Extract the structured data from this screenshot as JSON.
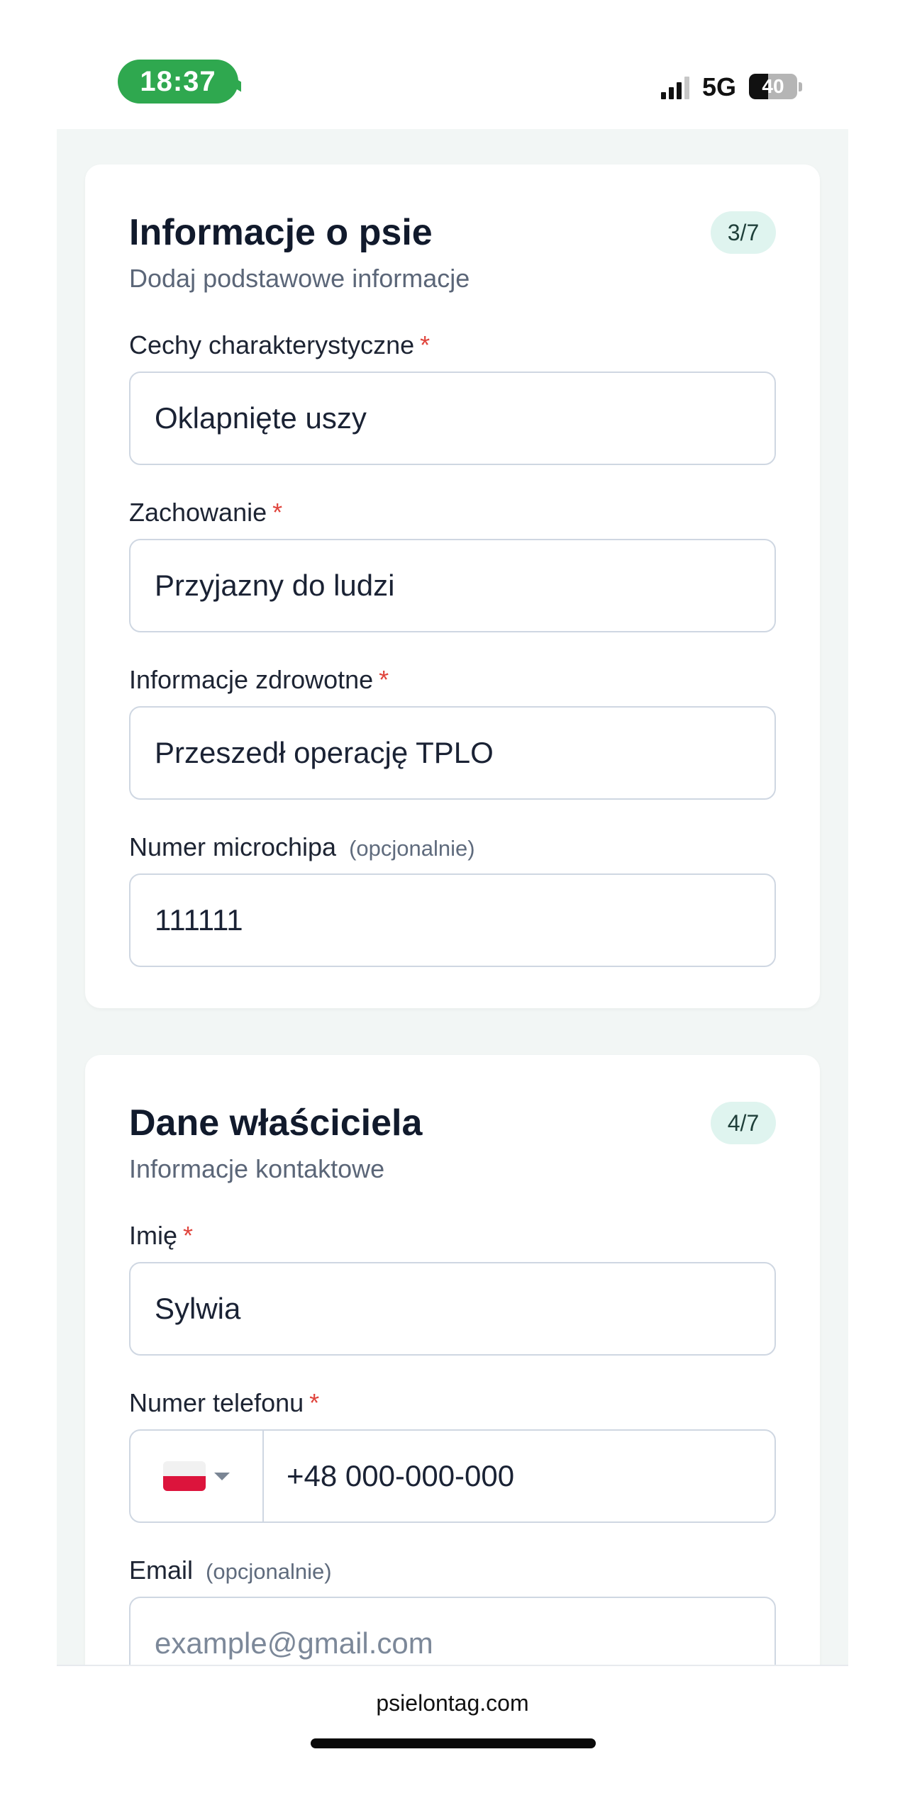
{
  "status_bar": {
    "time": "18:37",
    "network": "5G",
    "battery_level": "40",
    "battery_fraction": 0.4
  },
  "sections": [
    {
      "title": "Informacje o psie",
      "subtitle": "Dodaj podstawowe informacje",
      "step": "3/7",
      "fields": [
        {
          "label": "Cechy charakterystyczne",
          "required_mark": "*",
          "value": "Oklapnięte uszy"
        },
        {
          "label": "Zachowanie",
          "required_mark": "*",
          "value": "Przyjazny do ludzi"
        },
        {
          "label": "Informacje zdrowotne",
          "required_mark": "*",
          "value": "Przeszedł operację TPLO"
        },
        {
          "label": "Numer microchipa",
          "optional": "(opcjonalnie)",
          "value": "111111"
        }
      ]
    },
    {
      "title": "Dane właściciela",
      "subtitle": "Informacje kontaktowe",
      "step": "4/7",
      "fields": [
        {
          "label": "Imię",
          "required_mark": "*",
          "value": "Sylwia"
        },
        {
          "label": "Numer telefonu",
          "required_mark": "*",
          "country": "PL",
          "value": "+48 000-000-000"
        },
        {
          "label": "Email",
          "optional": "(opcjonalnie)",
          "placeholder": "example@gmail.com"
        }
      ]
    }
  ],
  "browser": {
    "url": "psielontag.com"
  },
  "colors": {
    "accent_green": "#2fa84f",
    "badge_bg": "#dff4ef",
    "required": "#e0453d",
    "page_bg": "#f2f6f5"
  }
}
